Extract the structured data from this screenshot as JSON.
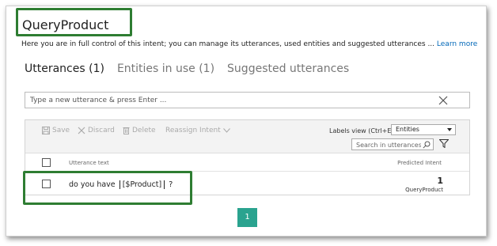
{
  "header": {
    "title": "QueryProduct",
    "description": "Here you are in full control of this intent; you can manage its utterances, used entities and suggested utterances ...",
    "learn_more": "Learn more"
  },
  "tabs": [
    {
      "label": "Utterances (1)",
      "active": true
    },
    {
      "label": "Entities in use (1)",
      "active": false
    },
    {
      "label": "Suggested utterances",
      "active": false
    }
  ],
  "utterance_input": {
    "placeholder": "Type a new utterance & press Enter ...",
    "value": ""
  },
  "toolbar": {
    "save": "Save",
    "discard": "Discard",
    "delete": "Delete",
    "reassign": "Reassign Intent",
    "labels_view_label": "Labels view (Ctrl+E):",
    "labels_view_value": "Entities",
    "search_placeholder": "Search in utterances ..."
  },
  "table": {
    "col_utterance": "Utterance text",
    "col_predicted": "Predicted Intent",
    "rows": [
      {
        "text_before": "do you have",
        "entity": "$Product",
        "text_after": "?",
        "predicted_score": "1",
        "predicted_intent": "QueryProduct"
      }
    ]
  },
  "pagination": {
    "current_page": "1"
  },
  "colors": {
    "highlight_green": "#2e7d32",
    "page_button": "#2aa38f",
    "link": "#0067b8"
  }
}
